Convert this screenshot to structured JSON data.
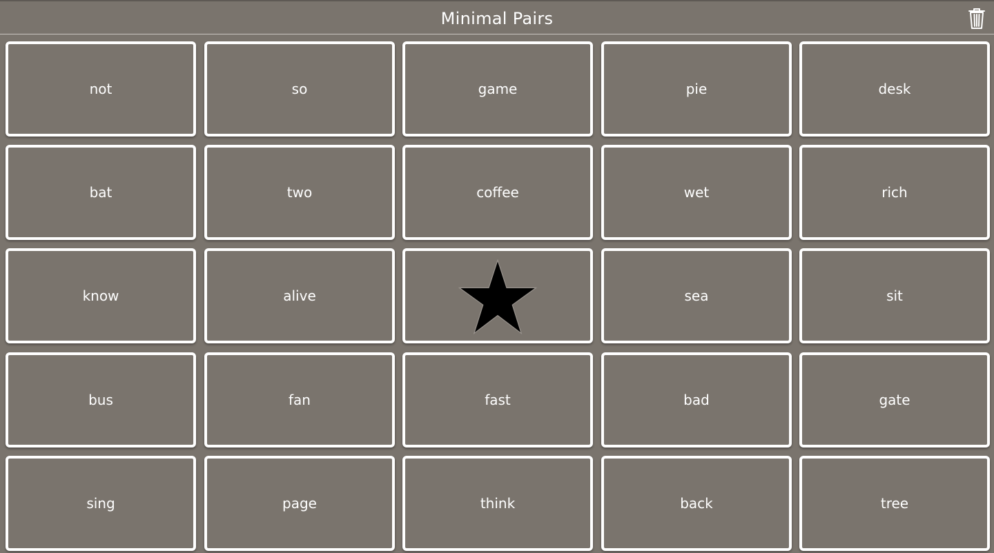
{
  "header": {
    "title": "Minimal Pairs",
    "trash_icon": "trash-icon"
  },
  "tiles": [
    "not",
    "so",
    "game",
    "pie",
    "desk",
    "bat",
    "two",
    "coffee",
    "wet",
    "rich",
    "know",
    "alive",
    "",
    "sea",
    "sit",
    "bus",
    "fan",
    "fast",
    "bad",
    "gate",
    "sing",
    "page",
    "think",
    "back",
    "tree"
  ],
  "free_space": {
    "index": 12,
    "icon": "star-icon"
  },
  "colors": {
    "background": "#7a746d",
    "tile_border": "#ffffff",
    "text": "#ffffff",
    "star": "#000000"
  }
}
